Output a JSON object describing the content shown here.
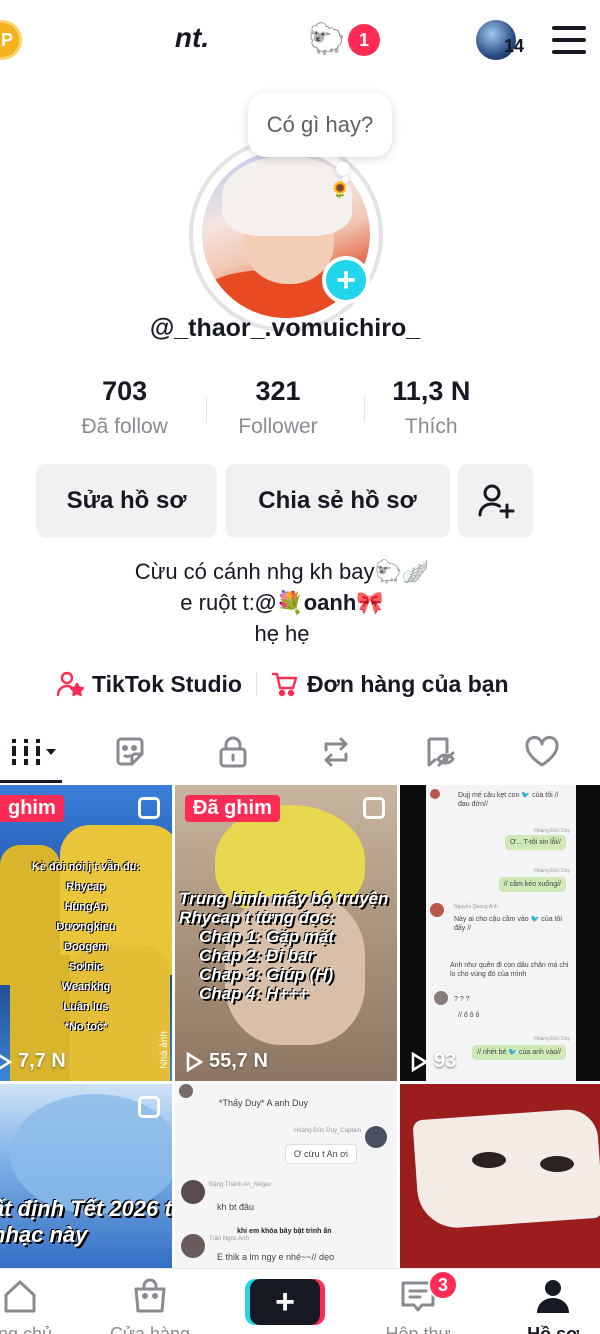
{
  "header": {
    "title": "nt.",
    "notification_count": "1",
    "account_count": "14",
    "coin_label": "P"
  },
  "profile": {
    "bubble_text": "Có gì hay?",
    "username": "@_thaor_.vomuichiro_",
    "stats": [
      {
        "value": "703",
        "label": "Đã follow"
      },
      {
        "value": "321",
        "label": "Follower"
      },
      {
        "value": "11,3 N",
        "label": "Thích"
      }
    ],
    "buttons": {
      "edit": "Sửa hồ sơ",
      "share": "Chia sẻ hồ sơ"
    },
    "bio": {
      "line1": "Cừu có cánh nhg kh bay🐑🪽",
      "line2_prefix": "e ruột t:",
      "line2_mention": "@💐oanh🎀",
      "line3": "hẹ hẹ"
    },
    "links": {
      "studio": "TikTok Studio",
      "orders": "Đơn hàng của bạn"
    }
  },
  "videos": [
    {
      "pinned_label": "ghim",
      "views": "7,7 N",
      "caption_lines": [
        "Kẻ đòi nói j t vẫn đu:",
        "Rhycap",
        "HùngAn",
        "Dươngkieu",
        "Doogem",
        "Sơlnic",
        "Weankhg",
        "Luân lus",
        "*No toć*"
      ],
      "watermark": "Nhà ảnh"
    },
    {
      "pinned_label": "Đã ghim",
      "views": "55,7 N",
      "caption_lines": [
        "Trung bình mấy bộ truyện",
        "Rhycap t từng đọc:",
        "Chap 1: Gặp mặt",
        "Chap 2: Đi bar",
        "Chap 3: Giúp (H)",
        "Chap 4: H+++"
      ]
    },
    {
      "views": "93",
      "chat_lines": [
        {
          "name": "",
          "text": "Dujj mé cậu kẹt con 🐦 của tôi // đau đớn//",
          "side": "left"
        },
        {
          "name": "Hoàng Đức Duy",
          "text": "Ơ... T-tôi xin lỗi//",
          "side": "right"
        },
        {
          "name": "Hoàng Đức Duy",
          "text": "// cầm kéo xuống//",
          "side": "right"
        },
        {
          "name": "Nguyễn Quang Anh",
          "text": "Này ai cho cậu cầm vào 🐦 của tôi đấy //",
          "side": "left"
        },
        {
          "name": "",
          "text": "Anh như quên đi con dâu chân má chỉ lo cho vùng đó của mình",
          "side": "left"
        },
        {
          "name": "",
          "text": "? ? ?",
          "side": "left"
        },
        {
          "name": "",
          "text": "// ô ô ô",
          "side": "left"
        },
        {
          "name": "Hoàng Đức Duy",
          "text": "// nhét bé 🐦 của anh vào//",
          "side": "right"
        }
      ]
    },
    {
      "caption_lines": [
        "ất định Tết 2026 t",
        "nhạc này"
      ]
    },
    {
      "chat_lines": [
        {
          "name": "",
          "text": "*Thấy Duy* A anh Duy",
          "side": "left"
        },
        {
          "name": "Hoàng Đức Duy_Captain",
          "text": "Ơ cừu t An ơi",
          "side": "right"
        },
        {
          "name": "Đặng Thành An_Negav",
          "text": "kh bt đâu",
          "side": "left"
        },
        {
          "name": "",
          "text": "khi em khóa bây bật trình ấn",
          "side": "left"
        },
        {
          "name": "Trần Ngọc Anh",
          "text": "E thik a lm ngy e nhé~~// dẹo",
          "side": "left"
        }
      ]
    },
    {}
  ],
  "nav": {
    "home": "ang chủ",
    "shop": "Cửa hàng",
    "inbox": "Hộp thư",
    "profile": "Hồ sơ",
    "inbox_badge": "3"
  },
  "colors": {
    "accent_red": "#fe2c55",
    "accent_cyan": "#20d5ec",
    "text": "#161823",
    "muted": "#8a8b91"
  },
  "icons": [
    "sheep-icon",
    "menu-icon",
    "add-user-icon",
    "studio-icon",
    "cart-icon",
    "grid-icon",
    "sticker-icon",
    "lock-icon",
    "repost-icon",
    "hidden-bookmark-icon",
    "heart-icon",
    "home-icon",
    "shop-icon",
    "inbox-icon",
    "profile-icon"
  ]
}
